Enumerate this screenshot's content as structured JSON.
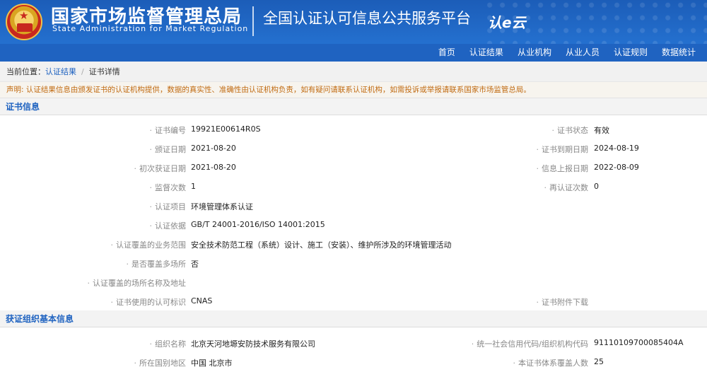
{
  "header": {
    "org_cn": "国家市场监督管理总局",
    "org_en": "State Administration for Market Regulation",
    "platform": "全国认证认可信息公共服务平台",
    "logo_text": "认e云",
    "emblem_icon": "national-emblem-icon"
  },
  "nav": {
    "items": [
      "首页",
      "认证结果",
      "从业机构",
      "从业人员",
      "认证规则",
      "数据统计"
    ]
  },
  "breadcrumb": {
    "prefix": "当前位置：",
    "item1": "认证结果",
    "separator": "/",
    "item2": "证书详情"
  },
  "notice": "声明: 认证结果信息由颁发证书的认证机构提供，数据的真实性、准确性由认证机构负责，如有疑问请联系认证机构，如需投诉或举报请联系国家市场监管总局。",
  "cert_section": {
    "title": "证书信息",
    "rows": [
      {
        "l1": "证书编号",
        "v1": "19921E00614R0S",
        "l2": "证书状态",
        "v2": "有效"
      },
      {
        "l1": "颁证日期",
        "v1": "2021-08-20",
        "l2": "证书到期日期",
        "v2": "2024-08-19"
      },
      {
        "l1": "初次获证日期",
        "v1": "2021-08-20",
        "l2": "信息上报日期",
        "v2": "2022-08-09"
      },
      {
        "l1": "监督次数",
        "v1": "1",
        "l2": "再认证次数",
        "v2": "0"
      },
      {
        "l1": "认证项目",
        "v1": "环境管理体系认证",
        "l2": "",
        "v2": ""
      },
      {
        "l1": "认证依据",
        "v1": "GB/T 24001-2016/ISO 14001:2015",
        "l2": "",
        "v2": ""
      },
      {
        "l1": "认证覆盖的业务范围",
        "v1": "安全技术防范工程（系统）设计、施工（安装）、维护所涉及的环境管理活动",
        "l2": "",
        "v2": ""
      },
      {
        "l1": "是否覆盖多场所",
        "v1": "否",
        "l2": "",
        "v2": ""
      },
      {
        "l1": "认证覆盖的场所名称及地址",
        "v1": "",
        "l2": "",
        "v2": ""
      },
      {
        "l1": "证书使用的认可标识",
        "v1": "CNAS",
        "l2": "证书附件下载",
        "v2": ""
      }
    ]
  },
  "org_section": {
    "title": "获证组织基本信息",
    "rows": [
      {
        "l1": "组织名称",
        "v1": "北京天河地塬安防技术服务有限公司",
        "l2": "统一社会信用代码/组织机构代码",
        "v2": "91110109700085404A"
      },
      {
        "l1": "所在国别地区",
        "v1": "中国 北京市",
        "l2": "本证书体系覆盖人数",
        "v2": "25"
      }
    ]
  }
}
